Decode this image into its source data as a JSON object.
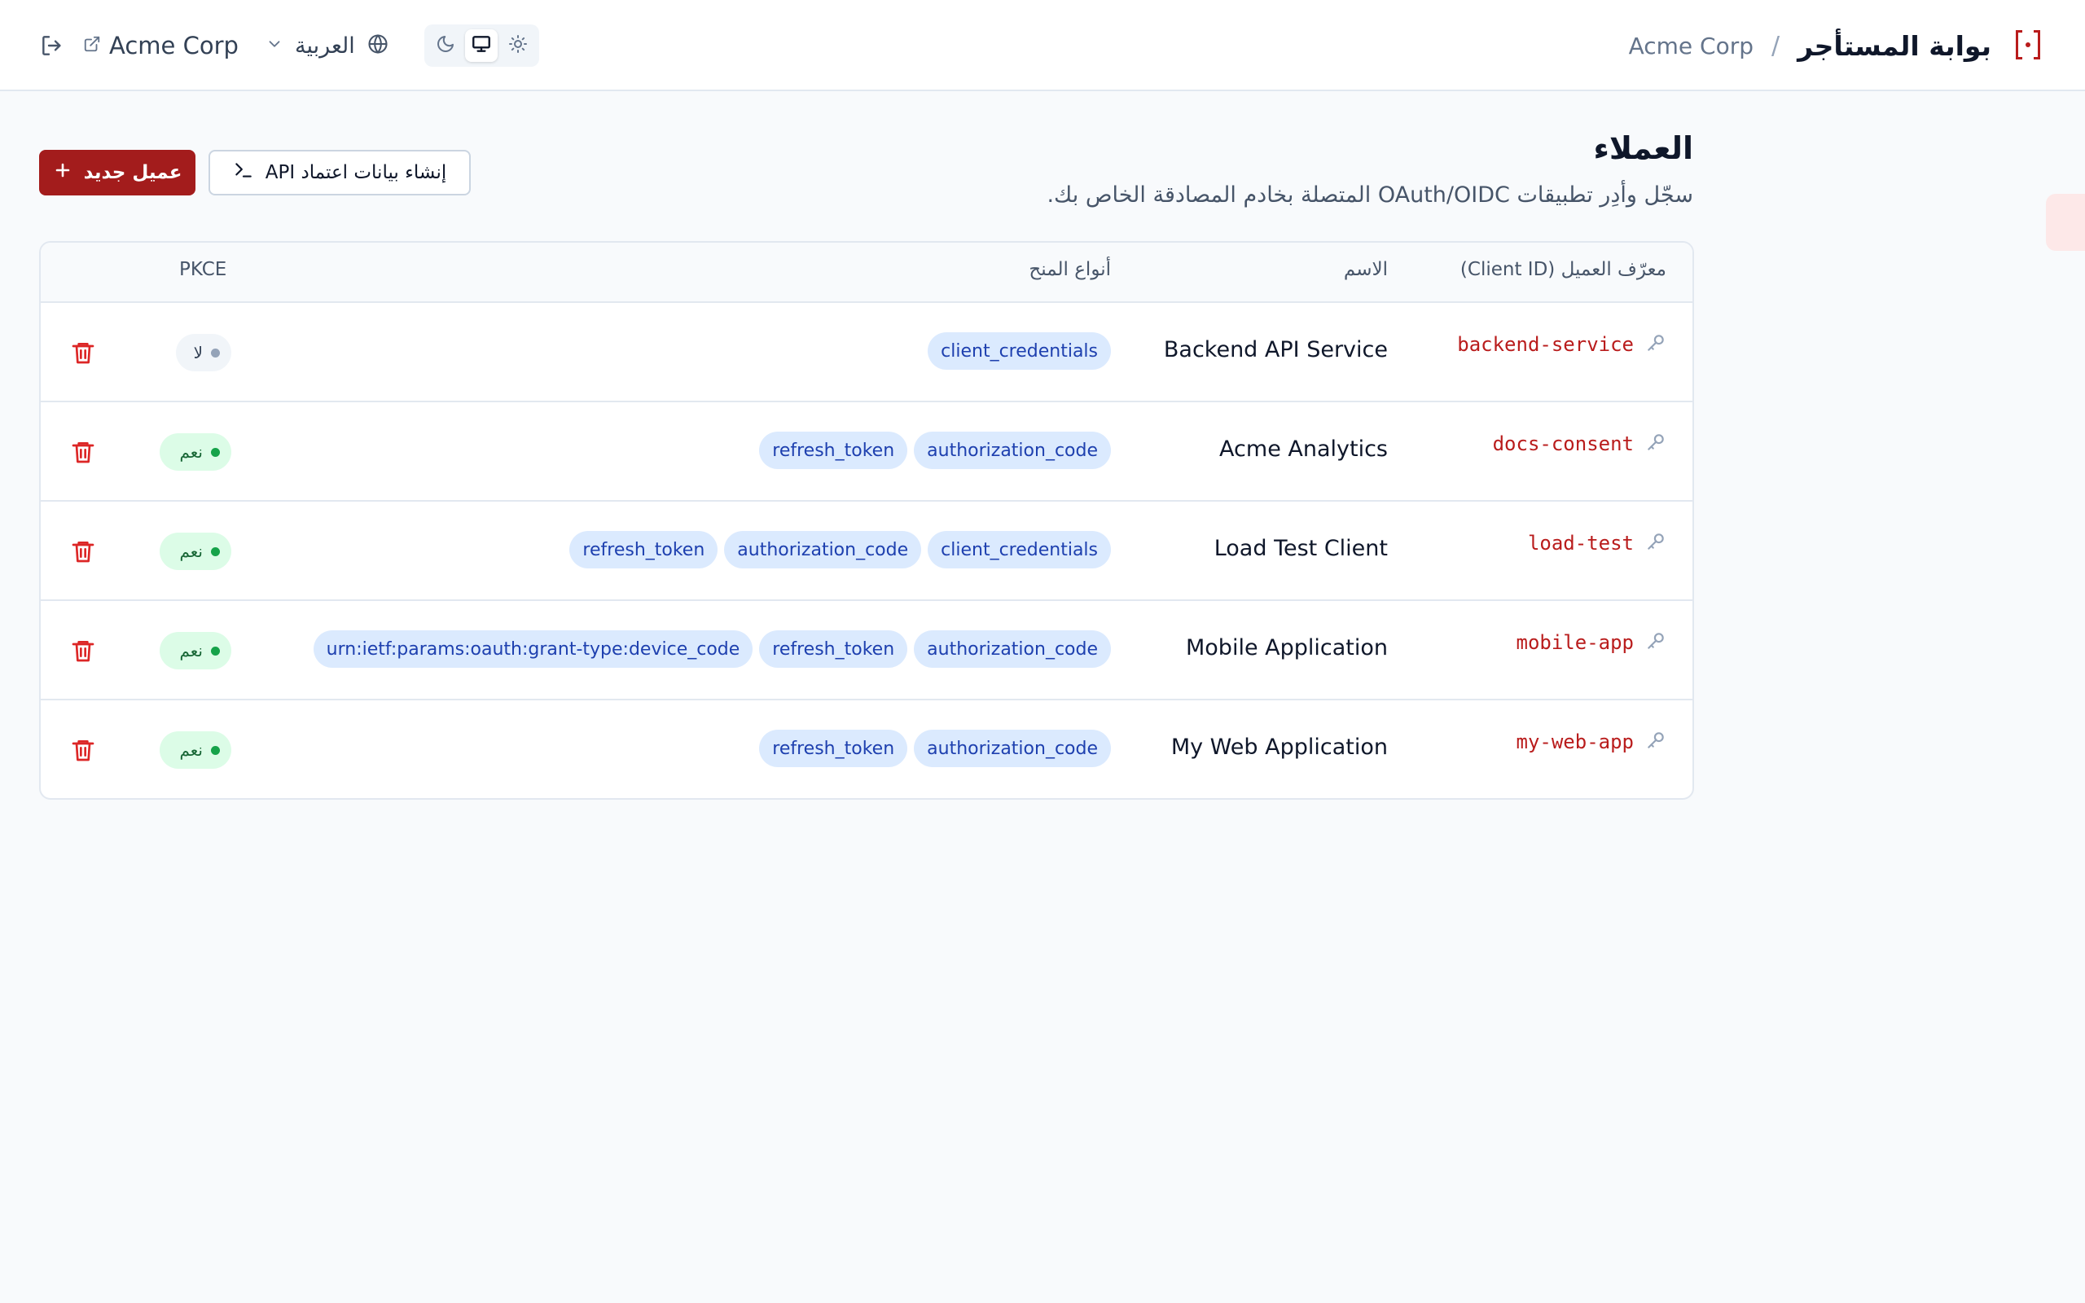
{
  "header": {
    "brand_title": "بوابة المستأجر",
    "separator": "/",
    "tenant_name": "Acme Corp",
    "tenant_link": "Acme Corp",
    "language": "العربية",
    "theme_active": "system"
  },
  "page": {
    "title": "العملاء",
    "subtitle": "سجّل وأدِر تطبيقات OAuth/OIDC المتصلة بخادم المصادقة الخاص بك.",
    "new_client_label": "عميل جديد",
    "api_credentials_label": "إنشاء بيانات اعتماد API"
  },
  "table": {
    "headers": {
      "client_id": "معرّف العميل (Client ID)",
      "name": "الاسم",
      "grant_types": "أنواع المنح",
      "pkce": "PKCE"
    },
    "rows": [
      {
        "client_id": "backend-service",
        "name": "Backend API Service",
        "grants": [
          "client_credentials"
        ],
        "pkce": "لا"
      },
      {
        "client_id": "docs-consent",
        "name": "Acme Analytics",
        "grants": [
          "authorization_code",
          "refresh_token"
        ],
        "pkce": "نعم"
      },
      {
        "client_id": "load-test",
        "name": "Load Test Client",
        "grants": [
          "client_credentials",
          "authorization_code",
          "refresh_token"
        ],
        "pkce": "نعم"
      },
      {
        "client_id": "mobile-app",
        "name": "Mobile Application",
        "grants": [
          "authorization_code",
          "refresh_token",
          "urn:ietf:params:oauth:grant-type:device_code"
        ],
        "pkce": "نعم"
      },
      {
        "client_id": "my-web-app",
        "name": "My Web Application",
        "grants": [
          "authorization_code",
          "refresh_token"
        ],
        "pkce": "نعم"
      }
    ]
  },
  "colors": {
    "brand": "#a31c1c",
    "client_id_text": "#b91c1c",
    "badge_bg": "#dbeafe",
    "badge_text": "#1e40af",
    "pkce_yes_bg": "#dcfce7",
    "pkce_no_bg": "#f1f5f9"
  }
}
